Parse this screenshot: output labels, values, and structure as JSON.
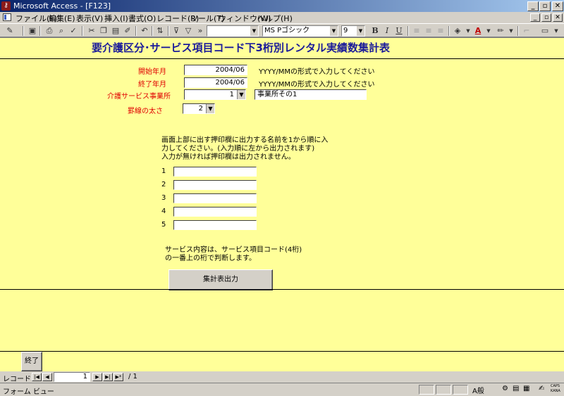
{
  "window": {
    "title": "Microsoft Access - [F123]",
    "controls": [
      "_",
      "▫",
      "✕"
    ]
  },
  "menu": {
    "items": [
      "ファイル(F)",
      "編集(E)",
      "表示(V)",
      "挿入(I)",
      "書式(O)",
      "レコード(R)",
      "ツール(T)",
      "ウィンドウ(W)",
      "ヘルプ(H)"
    ],
    "doc_controls": [
      "_",
      "▫",
      "✕"
    ]
  },
  "toolbar": {
    "font_name": "MS Pゴシック",
    "font_size": "9",
    "bold": "B",
    "italic": "I",
    "underline": "U"
  },
  "form": {
    "title": "要介護区分･サービス項目コード下3桁別レンタル実績数集計表",
    "start_label": "開始年月",
    "start_value": "2004/06",
    "start_hint": "YYYY/MMの形式で入力してください",
    "end_label": "終了年月",
    "end_value": "2004/06",
    "end_hint": "YYYY/MMの形式で入力してください",
    "office_label": "介護サービス事業所",
    "office_value": "1",
    "office_name": "事業所その1",
    "line_label": "罫線の太さ",
    "line_value": "2",
    "stamp_instructions": [
      "画面上部に出す押印欄に出力する名前を1から順に入",
      "力してください。(入力順に左から出力されます)",
      "入力が無ければ押印欄は出力されません。"
    ],
    "stamp_numbers": [
      "1",
      "2",
      "3",
      "4",
      "5"
    ],
    "note_lines": [
      "サービス内容は、サービス項目コード(4桁)",
      "の一番上の桁で判断します。"
    ],
    "output_button": "集計表出力",
    "close_button": "終了"
  },
  "recordnav": {
    "label": "レコード:",
    "current": "1",
    "total": "/ 1"
  },
  "statusbar": {
    "text": "フォーム ビュー",
    "ime": "A般",
    "caps": "CAPS",
    "kana": "KANA"
  }
}
